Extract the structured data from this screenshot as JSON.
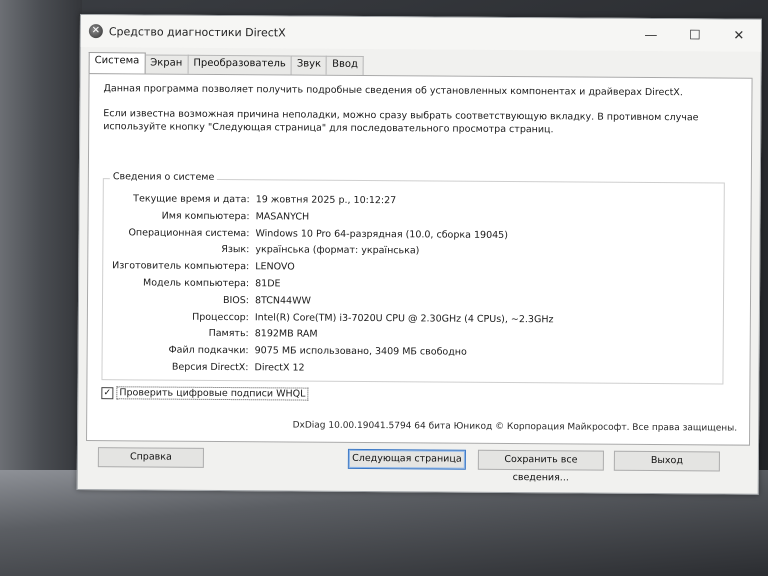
{
  "window": {
    "title": "Средство диагностики DirectX",
    "controls": {
      "minimize": "—",
      "maximize": "☐",
      "close": "✕"
    }
  },
  "tabs": [
    {
      "label": "Система",
      "active": true
    },
    {
      "label": "Экран",
      "active": false
    },
    {
      "label": "Преобразователь",
      "active": false
    },
    {
      "label": "Звук",
      "active": false
    },
    {
      "label": "Ввод",
      "active": false
    }
  ],
  "intro": {
    "line1": "Данная программа позволяет получить подробные сведения об установленных компонентах и драйверах DirectX.",
    "line2": "Если известна возможная причина неполадки, можно сразу выбрать соответствующую вкладку. В противном случае используйте кнопку \"Следующая страница\" для последовательного просмотра страниц."
  },
  "system_info": {
    "group_title": "Сведения о системе",
    "rows": [
      {
        "label": "Текущие время и дата:",
        "value": "19 жовтня 2025 р., 10:12:27"
      },
      {
        "label": "Имя компьютера:",
        "value": "MASANYCH"
      },
      {
        "label": "Операционная система:",
        "value": "Windows 10 Pro 64-разрядная (10.0, сборка 19045)"
      },
      {
        "label": "Язык:",
        "value": "українська (формат: українська)"
      },
      {
        "label": "Изготовитель компьютера:",
        "value": "LENOVO"
      },
      {
        "label": "Модель компьютера:",
        "value": "81DE"
      },
      {
        "label": "BIOS:",
        "value": "8TCN44WW"
      },
      {
        "label": "Процессор:",
        "value": "Intel(R) Core(TM) i3-7020U CPU @ 2.30GHz (4 CPUs), ~2.3GHz"
      },
      {
        "label": "Память:",
        "value": "8192MB RAM"
      },
      {
        "label": "Файл подкачки:",
        "value": "9075 МБ использовано, 3409 МБ свободно"
      },
      {
        "label": "Версия DirectX:",
        "value": "DirectX 12"
      }
    ]
  },
  "whql": {
    "label": "Проверить цифровые подписи WHQL",
    "checked": true,
    "check_mark": "✓"
  },
  "footer": "DxDiag 10.00.19041.5794 64 бита Юникод © Корпорация Майкрософт. Все права защищены.",
  "buttons": {
    "help": "Справка",
    "next": "Следующая страница",
    "save": "Сохранить все сведения...",
    "exit": "Выход"
  }
}
